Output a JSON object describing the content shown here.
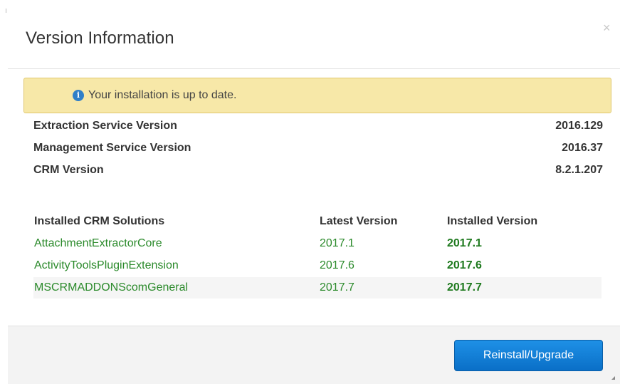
{
  "dialog": {
    "title": "Version Information",
    "close_glyph": "×"
  },
  "alert": {
    "text": "Your installation is up to date.",
    "icon": "info-icon",
    "icon_glyph": "i"
  },
  "versions": [
    {
      "label": "Extraction Service Version",
      "value": "2016.129"
    },
    {
      "label": "Management Service Version",
      "value": "2016.37"
    },
    {
      "label": "CRM Version",
      "value": "8.2.1.207"
    }
  ],
  "solutions": {
    "headers": [
      "Installed CRM Solutions",
      "Latest Version",
      "Installed Version"
    ],
    "rows": [
      {
        "name": "AttachmentExtractorCore",
        "latest": "2017.1",
        "installed": "2017.1"
      },
      {
        "name": "ActivityToolsPluginExtension",
        "latest": "2017.6",
        "installed": "2017.6"
      },
      {
        "name": "MSCRMADDONScomGeneral",
        "latest": "2017.7",
        "installed": "2017.7"
      }
    ]
  },
  "footer": {
    "button_label": "Reinstall/Upgrade"
  },
  "colors": {
    "alert_bg": "#f7e8a8",
    "solution_text": "#2b8a2b",
    "button": "#1480d8"
  }
}
